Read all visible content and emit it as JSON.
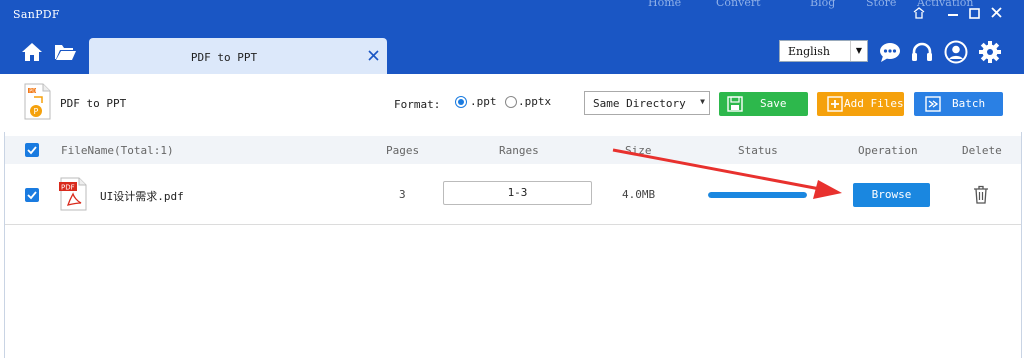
{
  "window": {
    "title": "SanPDF",
    "ghost_labels": [
      "Home",
      "Convert",
      "Blog",
      "Store",
      "Activation"
    ]
  },
  "toolbar": {
    "tab_label": "PDF to PPT",
    "language": "English"
  },
  "converter": {
    "title": "PDF to PPT",
    "format_label": "Format:",
    "format_options": [
      ".ppt",
      ".pptx"
    ],
    "selected_format": ".ppt",
    "directory": "Same Directory",
    "save_label": "Save",
    "add_files_label": "Add Files",
    "batch_label": "Batch"
  },
  "table": {
    "headers": {
      "filename": "FileName(Total:1)",
      "pages": "Pages",
      "ranges": "Ranges",
      "size": "Size",
      "status": "Status",
      "operation": "Operation",
      "delete": "Delete"
    },
    "rows": [
      {
        "filename": "UI设计需求.pdf",
        "pages": "3",
        "range": "1-3",
        "size": "4.0MB",
        "progress": 1.0,
        "operation_label": "Browse"
      }
    ]
  },
  "colors": {
    "brand": "#1a56c4",
    "accent": "#1a87e0",
    "save": "#2db84c",
    "add_files": "#f5a10c",
    "batch": "#2a80e4",
    "annotation_arrow": "#e8312e"
  }
}
